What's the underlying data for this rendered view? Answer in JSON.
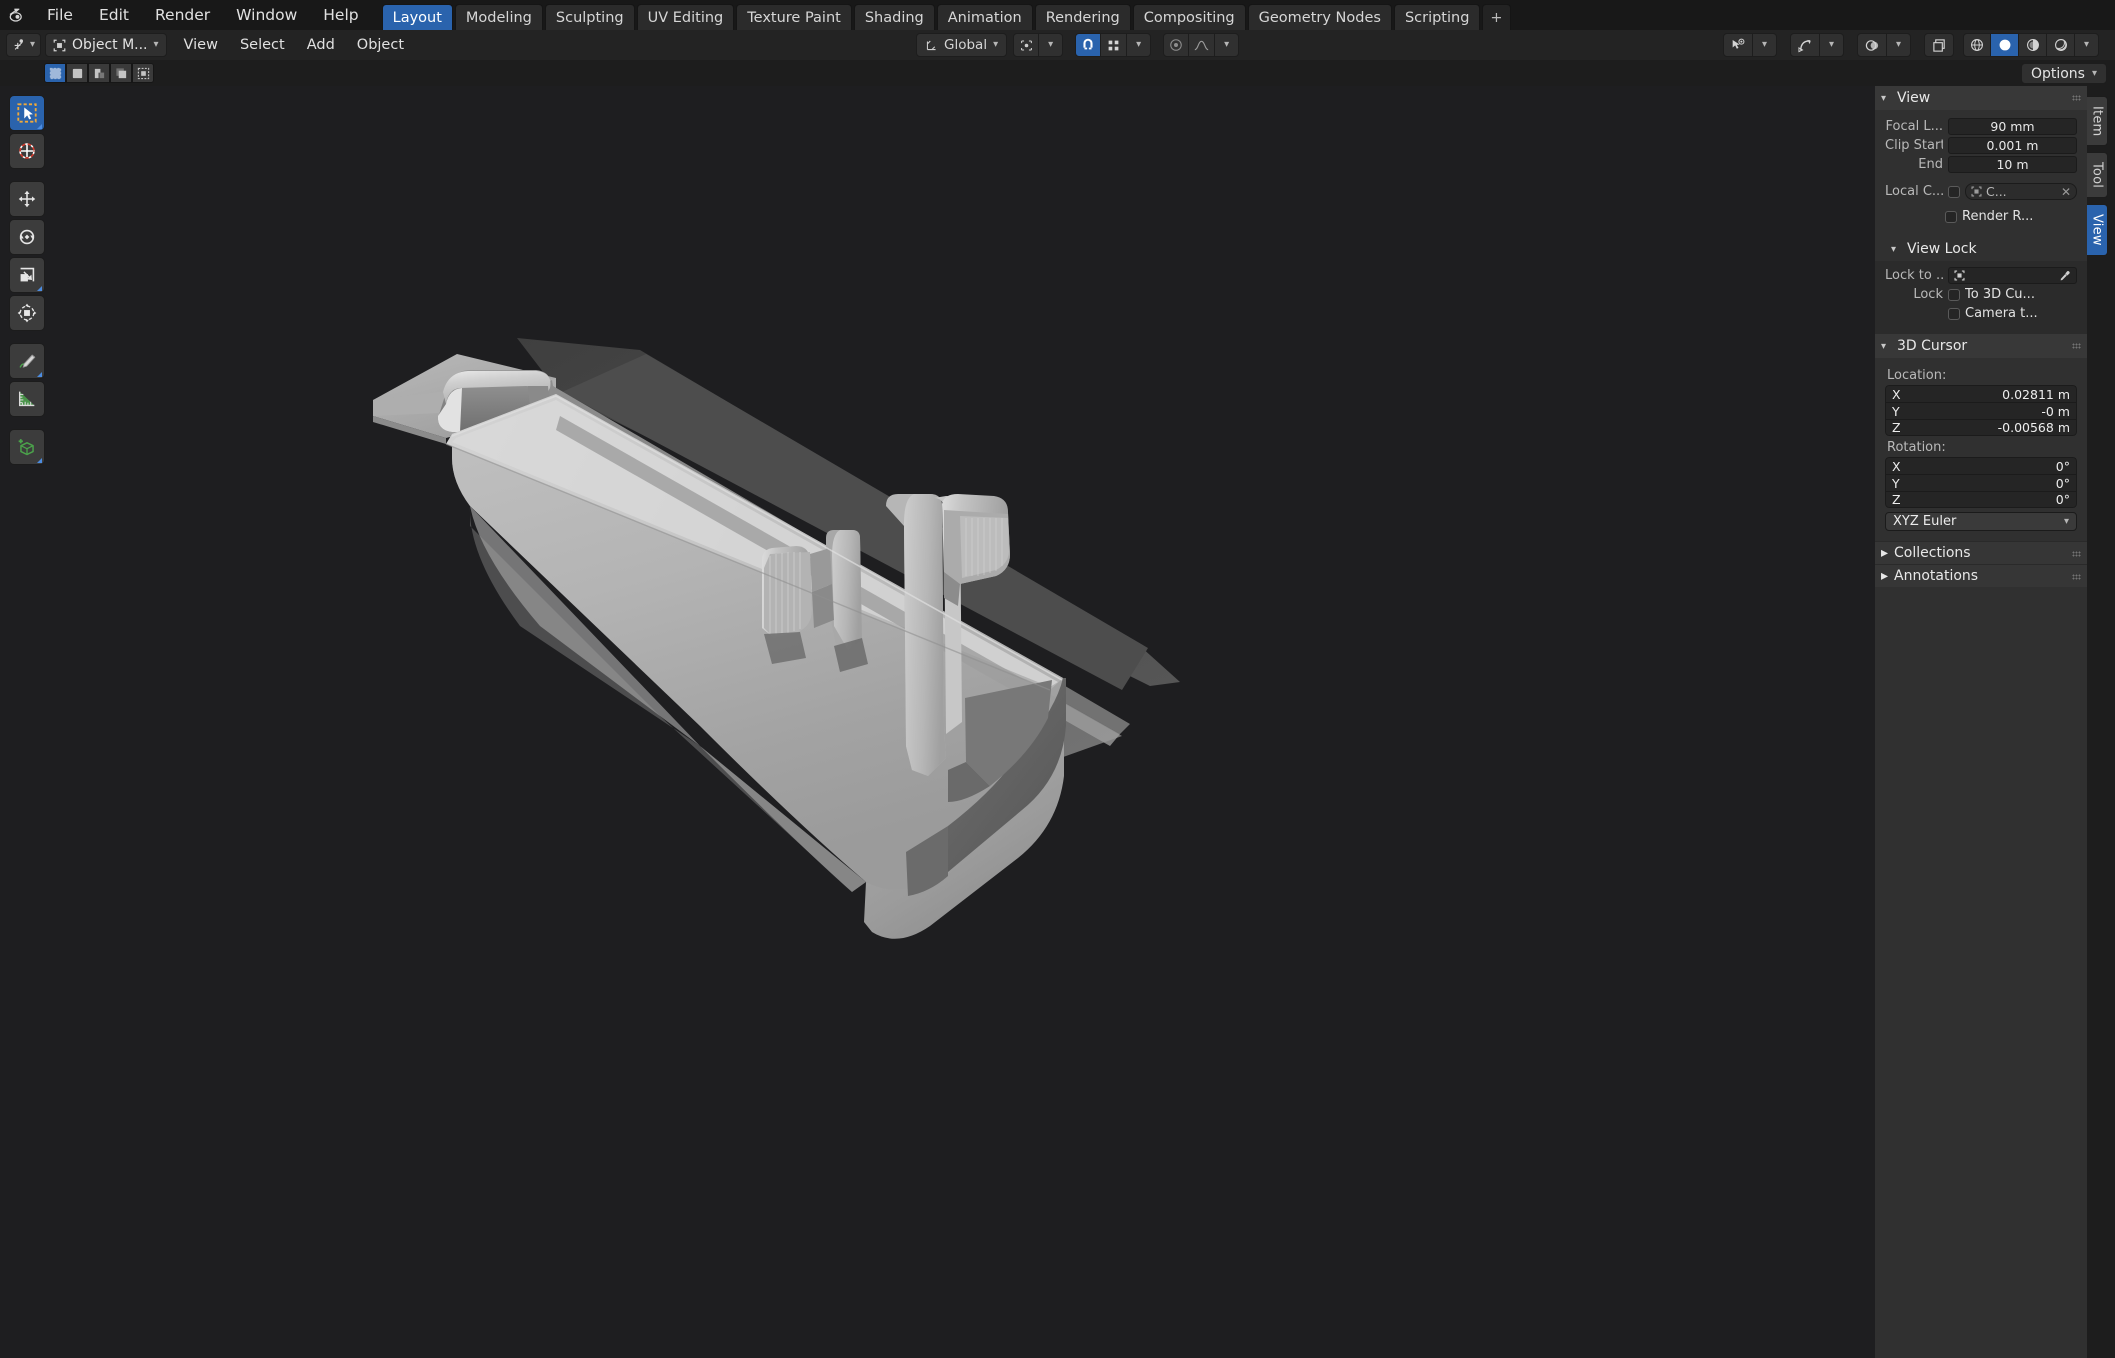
{
  "app": {
    "logo_icon": "blender-logo-icon"
  },
  "topbar": {
    "menus": [
      "File",
      "Edit",
      "Render",
      "Window",
      "Help"
    ],
    "workspace_tabs": [
      "Layout",
      "Modeling",
      "Sculpting",
      "UV Editing",
      "Texture Paint",
      "Shading",
      "Animation",
      "Rendering",
      "Compositing",
      "Geometry Nodes",
      "Scripting"
    ],
    "active_workspace": "Layout",
    "add_workspace_label": "+"
  },
  "viewport_header": {
    "editor_type_icon": "editor-type-icon",
    "mode_label": "Object M...",
    "mode_icon": "object-mode-icon",
    "menus": [
      "View",
      "Select",
      "Add",
      "Object"
    ],
    "transform_orientation": "Global",
    "transform_orientation_icon": "orientation-axes-icon",
    "pivot_icon": "pivot-point-icon",
    "snap_icon": "snap-magnet-icon",
    "snap_target_icon": "snap-target-icon",
    "proportional_icon": "proportional-edit-icon",
    "falloff_icon": "proportional-falloff-icon",
    "right_icons": [
      "visibility-selectability-icon",
      "show-gizmo-icon",
      "show-overlays-icon",
      "xray-toggle-icon",
      "shading-wireframe-icon",
      "shading-solid-icon",
      "shading-material-icon",
      "shading-rendered-icon"
    ],
    "active_shading": "shading-solid-icon"
  },
  "tool_settings": {
    "select_modes": [
      "select-box-icon",
      "select-tweak-icon",
      "select-extend-icon",
      "select-subtract-icon",
      "select-difference-icon"
    ],
    "active_select_mode": "select-box-icon",
    "options_label": "Options"
  },
  "toolbar": {
    "tools": [
      {
        "name": "tweak-tool",
        "icon": "cursor-arrow-icon",
        "active": true,
        "has_corner": true
      },
      {
        "name": "cursor-tool",
        "icon": "3d-cursor-icon",
        "active": false,
        "has_corner": false
      },
      {
        "name": "move-tool",
        "icon": "move-arrows-icon",
        "active": false,
        "has_corner": false
      },
      {
        "name": "rotate-tool",
        "icon": "rotate-icon",
        "active": false,
        "has_corner": false
      },
      {
        "name": "scale-tool",
        "icon": "scale-icon",
        "active": false,
        "has_corner": true
      },
      {
        "name": "transform-tool",
        "icon": "transform-icon",
        "active": false,
        "has_corner": false
      },
      {
        "name": "annotate-tool",
        "icon": "pencil-icon",
        "active": false,
        "has_corner": true
      },
      {
        "name": "measure-tool",
        "icon": "ruler-icon",
        "active": false,
        "has_corner": false
      },
      {
        "name": "add-cube-tool",
        "icon": "add-cube-icon",
        "active": false,
        "has_corner": true
      }
    ]
  },
  "npanel": {
    "view": {
      "title": "View",
      "focal_label": "Focal L...",
      "focal_value": "90 mm",
      "clip_start_label": "Clip Start",
      "clip_start_value": "0.001 m",
      "clip_end_label": "End",
      "clip_end_value": "10 m",
      "local_camera_label": "Local C...",
      "local_camera_checkbox": false,
      "local_camera_id": "C...",
      "local_camera_id_icon": "camera-data-icon",
      "local_camera_clear_icon": "close-x-icon",
      "render_region_label": "Render R...",
      "render_region_checkbox": false
    },
    "view_lock": {
      "title": "View Lock",
      "lock_to_label": "Lock to ...",
      "lock_to_icon": "object-data-icon",
      "eyedropper_icon": "eyedropper-icon",
      "lock_label": "Lock",
      "lock_3d_cursor_label": "To 3D Cu...",
      "lock_3d_cursor_checked": false,
      "lock_camera_label": "Camera t...",
      "lock_camera_checked": false
    },
    "cursor_3d": {
      "title": "3D Cursor",
      "location_label": "Location:",
      "location": [
        {
          "axis": "X",
          "value": "0.02811 m"
        },
        {
          "axis": "Y",
          "value": "-0 m"
        },
        {
          "axis": "Z",
          "value": "-0.00568 m"
        }
      ],
      "rotation_label": "Rotation:",
      "rotation": [
        {
          "axis": "X",
          "value": "0°"
        },
        {
          "axis": "Y",
          "value": "0°"
        },
        {
          "axis": "Z",
          "value": "0°"
        }
      ],
      "rotation_mode": "XYZ Euler"
    },
    "collections": {
      "title": "Collections"
    },
    "annotations": {
      "title": "Annotations"
    },
    "tabs": [
      "Item",
      "Tool",
      "View"
    ],
    "active_tab": "View"
  },
  "colors": {
    "accent_blue": "#2a63ad",
    "viewport_bg": "#1e1e20",
    "panel_bg": "#303030",
    "header_bg": "#232323",
    "topbar_bg": "#181818",
    "model_light": "#c9c9c9",
    "model_mid": "#9a9a9a",
    "model_dark": "#6d6d6d",
    "model_shadow": "#4a4a4a"
  },
  "scene": {
    "object_description": "Grey shaded 3D model of an open trough / bracket shaped part with a flat flange at left, two upright tabs, and a curved rounded base"
  }
}
